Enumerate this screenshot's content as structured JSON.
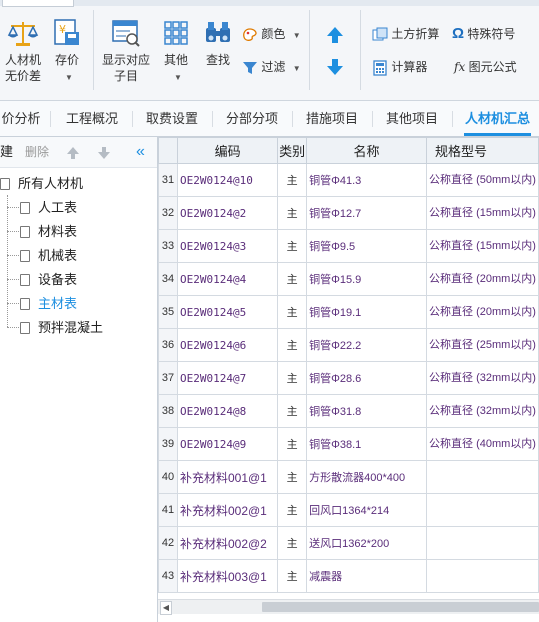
{
  "ribbon": {
    "rcj_wujiacha": [
      "人材机",
      "无价差"
    ],
    "cunjia": "存价",
    "show_sub": [
      "显示对应",
      "子目"
    ],
    "other": "其他",
    "find": "查找",
    "color": "颜色",
    "filter": "过滤",
    "earthwork": "土方折算",
    "special_char": "特殊符号",
    "calculator": "计算器",
    "formula": "图元公式"
  },
  "tabs": [
    "价分析",
    "工程概况",
    "取费设置",
    "分部分项",
    "措施项目",
    "其他项目",
    "人材机汇总"
  ],
  "left_toolbar": {
    "new": "建",
    "delete": "删除"
  },
  "tree": {
    "root": "所有人材机",
    "children": [
      "人工表",
      "材料表",
      "机械表",
      "设备表",
      "主材表",
      "预拌混凝土"
    ]
  },
  "grid": {
    "headers": [
      "",
      "编码",
      "类别",
      "名称",
      "规格型号"
    ],
    "rows": [
      {
        "n": "31",
        "code": "OE2W0124@10",
        "cat": "主",
        "name": "铜管Φ41.3",
        "spec": "公称直径 (50mm以内)"
      },
      {
        "n": "32",
        "code": "OE2W0124@2",
        "cat": "主",
        "name": "铜管Φ12.7",
        "spec": "公称直径 (15mm以内)"
      },
      {
        "n": "33",
        "code": "OE2W0124@3",
        "cat": "主",
        "name": "铜管Φ9.5",
        "spec": "公称直径 (15mm以内)"
      },
      {
        "n": "34",
        "code": "OE2W0124@4",
        "cat": "主",
        "name": "铜管Φ15.9",
        "spec": "公称直径 (20mm以内)"
      },
      {
        "n": "35",
        "code": "OE2W0124@5",
        "cat": "主",
        "name": "铜管Φ19.1",
        "spec": "公称直径 (20mm以内)"
      },
      {
        "n": "36",
        "code": "OE2W0124@6",
        "cat": "主",
        "name": "铜管Φ22.2",
        "spec": "公称直径 (25mm以内)"
      },
      {
        "n": "37",
        "code": "OE2W0124@7",
        "cat": "主",
        "name": "铜管Φ28.6",
        "spec": "公称直径 (32mm以内)"
      },
      {
        "n": "38",
        "code": "OE2W0124@8",
        "cat": "主",
        "name": "铜管Φ31.8",
        "spec": "公称直径 (32mm以内)"
      },
      {
        "n": "39",
        "code": "OE2W0124@9",
        "cat": "主",
        "name": "铜管Φ38.1",
        "spec": "公称直径 (40mm以内)"
      },
      {
        "n": "40",
        "code": "补充材料001@1",
        "cat": "主",
        "name": "方形散流器400*400",
        "spec": ""
      },
      {
        "n": "41",
        "code": "补充材料002@1",
        "cat": "主",
        "name": "回风口1364*214",
        "spec": ""
      },
      {
        "n": "42",
        "code": "补充材料002@2",
        "cat": "主",
        "name": "送风口1362*200",
        "spec": ""
      },
      {
        "n": "43",
        "code": "补充材料003@1",
        "cat": "主",
        "name": "减震器",
        "spec": ""
      }
    ]
  }
}
